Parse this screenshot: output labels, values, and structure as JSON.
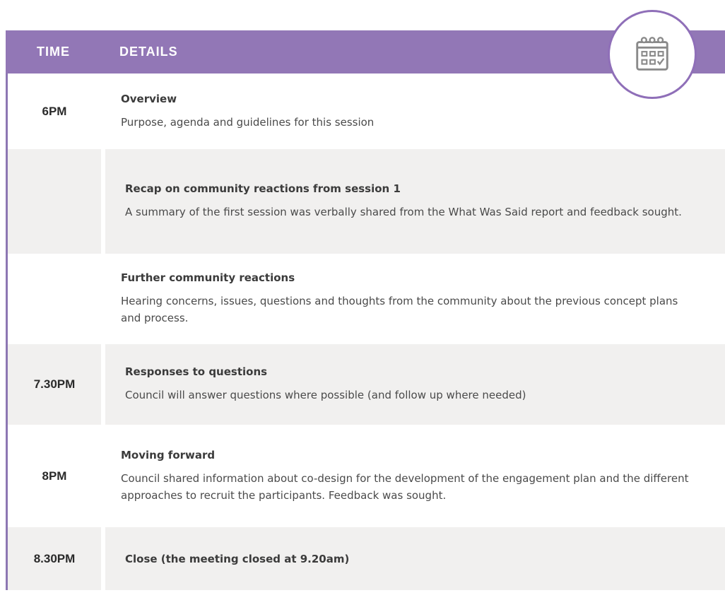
{
  "header": {
    "time_label": "TIME",
    "details_label": "DETAILS"
  },
  "icon": {
    "name": "calendar-icon"
  },
  "colors": {
    "header": "#9277b6",
    "row_grey": "#f1f0ef",
    "border": "#8d77b3"
  },
  "rows": [
    {
      "time": "6PM",
      "title": "Overview",
      "desc": "Purpose, agenda and guidelines for this session"
    },
    {
      "time": "",
      "title": "Recap on community reactions from session 1",
      "desc": "A summary of the first session was verbally shared from the What Was Said report and feedback sought."
    },
    {
      "time": "",
      "title": "Further community reactions",
      "desc": "Hearing concerns, issues, questions and thoughts from the community about the previous concept plans and process."
    },
    {
      "time": "7.30PM",
      "title": "Responses to questions",
      "desc": "Council will answer questions where possible (and follow up where needed)"
    },
    {
      "time": "8PM",
      "title": "Moving forward",
      "desc": "Council shared information about co-design for the development of the engagement plan and the different approaches to recruit the participants. Feedback was sought."
    },
    {
      "time": "8.30PM",
      "title": "Close  (the meeting closed at 9.20am)",
      "desc": ""
    }
  ]
}
